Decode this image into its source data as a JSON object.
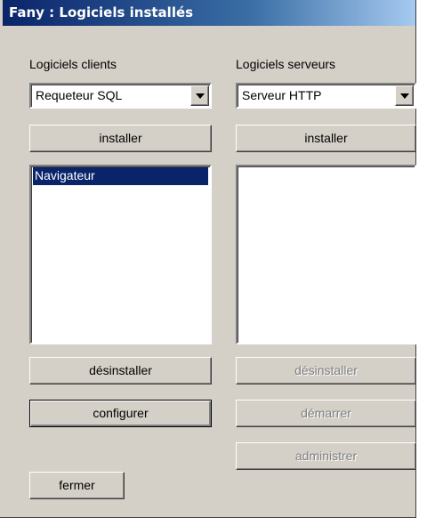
{
  "window": {
    "title": "Fany : Logiciels installés"
  },
  "clients": {
    "label": "Logiciels clients",
    "selected": "Requeteur SQL",
    "install_label": "installer",
    "installed": [
      {
        "label": "Navigateur",
        "selected": true
      }
    ],
    "uninstall_label": "désinstaller",
    "configure_label": "configurer"
  },
  "servers": {
    "label": "Logiciels serveurs",
    "selected": "Serveur HTTP",
    "install_label": "installer",
    "installed": [],
    "uninstall_label": "désinstaller",
    "start_label": "démarrer",
    "admin_label": "administrer"
  },
  "close_label": "fermer"
}
